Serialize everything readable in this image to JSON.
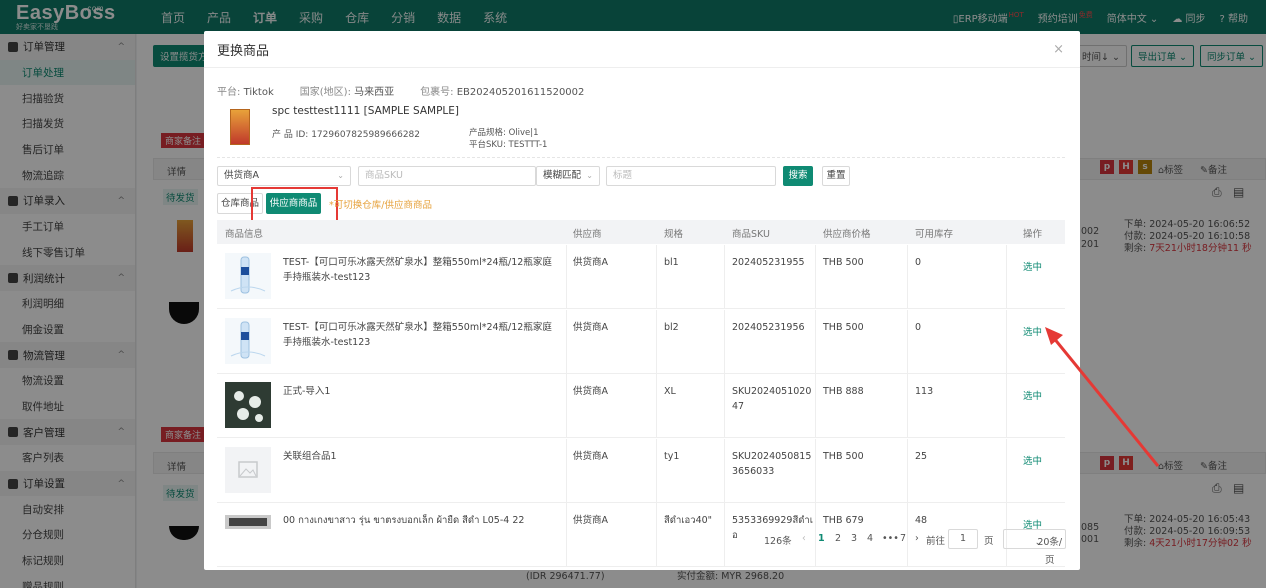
{
  "app": {
    "logo": "EasyBoss",
    "logo_com": ".com",
    "logo_tagline": "好卖家不垦践"
  },
  "topnav": [
    "首页",
    "产品",
    "订单",
    "采购",
    "仓库",
    "分销",
    "数据",
    "系统"
  ],
  "topright": {
    "mobile": "ERP移动端",
    "mobile_badge": "HOT",
    "training": "预约培训",
    "training_badge": "免费",
    "lang": "简体中文",
    "sync": "同步",
    "help": "帮助"
  },
  "sidebar": [
    {
      "group": "订单管理",
      "items": [
        "订单处理",
        "扫描验货",
        "扫描发货",
        "售后订单",
        "物流追踪"
      ]
    },
    {
      "group": "订单录入",
      "items": [
        "手工订单",
        "线下零售订单"
      ]
    },
    {
      "group": "利润统计",
      "items": [
        "利润明细",
        "佣金设置"
      ]
    },
    {
      "group": "物流管理",
      "items": [
        "物流设置",
        "取件地址"
      ]
    },
    {
      "group": "客户管理",
      "items": [
        "客户列表"
      ]
    },
    {
      "group": "订单设置",
      "items": [
        "自动安排",
        "分仓规则",
        "标记规则",
        "赠品规则"
      ]
    }
  ],
  "background": {
    "set_shipping": "设置揽货方",
    "sort_time": "时间↓",
    "export_orders": "导出订单",
    "sync_orders": "同步订单",
    "merchant_note": "商家备注",
    "detail": "详情",
    "pending": "待发货",
    "tag_label": "标签",
    "note_label": "备注",
    "order1_id_a": "002",
    "order1_id_b": "201",
    "order1_placed": "下单: 2024-05-20 16:06:52",
    "order1_paid": "付款: 2024-05-20 16:10:58",
    "order1_remain_label": "剩余:",
    "order1_remain": "7天21小时18分钟11 秒",
    "order2_id_a": "085",
    "order2_id_b": "001",
    "order2_placed": "下单: 2024-05-20 16:05:43",
    "order2_paid": "付款: 2024-05-20 16:09:53",
    "order2_remain_label": "剩余:",
    "order2_remain": "4天21小时17分钟02 秒",
    "idr_total": "(IDR 296471.77)",
    "paid_amount": "实付金额: MYR 2968.20"
  },
  "modal": {
    "title": "更换商品",
    "close": "×",
    "platform_label": "平台:",
    "platform": "Tiktok",
    "country_label": "国家(地区):",
    "country": "马来西亚",
    "package_label": "包裹号:",
    "package": "EB202405201611520002",
    "product_name": "spc testtest1111 [SAMPLE SAMPLE]",
    "product_id": "产 品 ID: 1729607825989666282",
    "product_spec": "产品规格: Olive|1",
    "platform_sku": "平台SKU: TESTTT-1",
    "supplier_select": "供货商A",
    "sku_placeholder": "商品SKU",
    "match_mode": "模糊匹配",
    "title_placeholder": "标题",
    "search_btn": "搜索",
    "reset_btn": "重置",
    "tab_warehouse": "仓库商品",
    "tab_supplier": "供应商商品",
    "tip": "*可切换仓库/供应商商品",
    "columns": [
      "商品信息",
      "供应商",
      "规格",
      "商品SKU",
      "供应商价格",
      "可用库存",
      "操作"
    ],
    "rows": [
      {
        "name": "TEST-【可口可乐冰露天然矿泉水】整箱550ml*24瓶/12瓶家庭手持瓶装水-test123",
        "supplier": "供货商A",
        "spec": "bl1",
        "sku": "202405231955",
        "price": "THB 500",
        "stock": "0",
        "action": "选中",
        "img": "water"
      },
      {
        "name": "TEST-【可口可乐冰露天然矿泉水】整箱550ml*24瓶/12瓶家庭手持瓶装水-test123",
        "supplier": "供货商A",
        "spec": "bl2",
        "sku": "202405231956",
        "price": "THB 500",
        "stock": "0",
        "action": "选中",
        "img": "water"
      },
      {
        "name": "正式-导入1",
        "supplier": "供货商A",
        "spec": "XL",
        "sku": "SKU202405102047",
        "price": "THB 888",
        "stock": "113",
        "action": "选中",
        "img": "dark"
      },
      {
        "name": "关联组合品1",
        "supplier": "供货商A",
        "spec": "ty1",
        "sku": "SKU20240508153656033",
        "price": "THB 500",
        "stock": "25",
        "action": "选中",
        "img": "placeholder"
      },
      {
        "name": "00 กางเกงขาสาว รุ่น ขาตรงบอกเล็ก ผ้ายืด สีดำ L05-4 22",
        "supplier": "供货商A",
        "spec": "สีดำเอว40\"",
        "sku": "5353369929สีดำเอ",
        "price": "THB 679",
        "stock": "48",
        "action": "选中",
        "img": "pants"
      }
    ],
    "pager": {
      "total": "126条",
      "pages": [
        "1",
        "2",
        "3",
        "4",
        "•••",
        "7"
      ],
      "goto": "前往",
      "goto_value": "1",
      "page_unit": "页",
      "per_page": "20条/页"
    }
  }
}
